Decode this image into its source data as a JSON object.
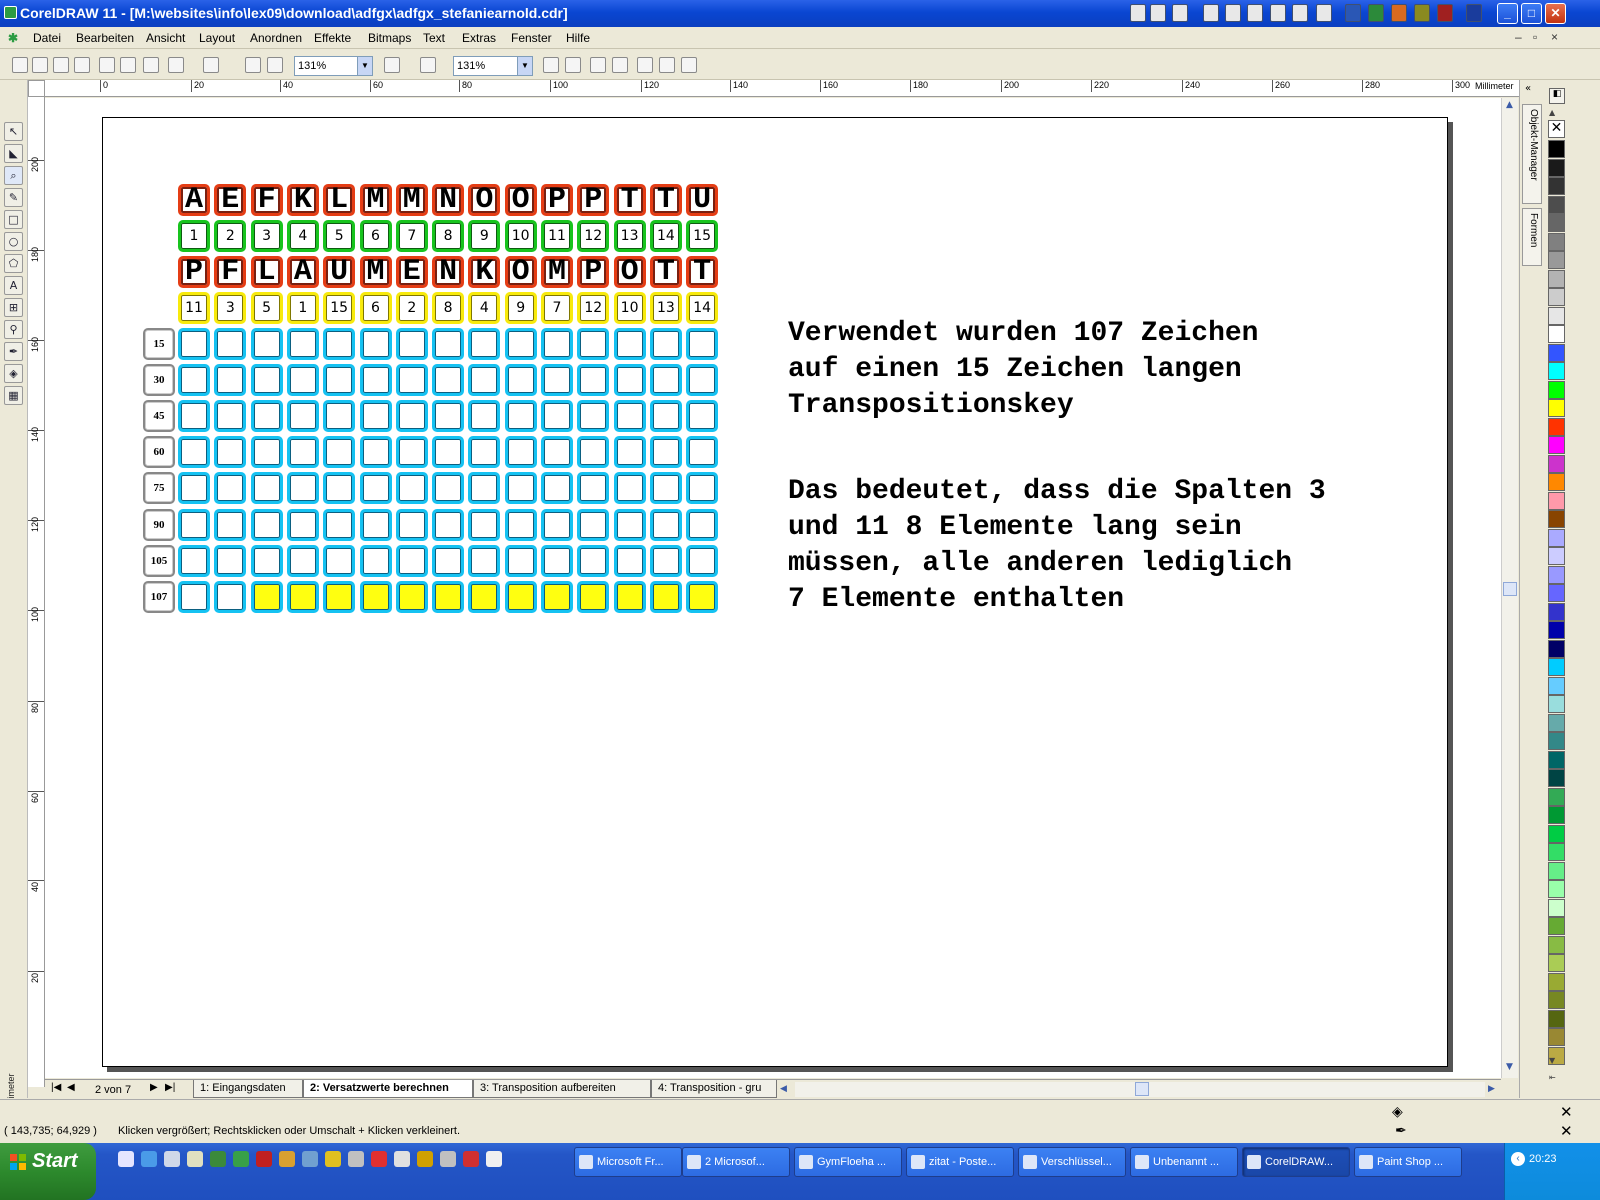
{
  "window": {
    "title": "CorelDRAW 11 - [M:\\websites\\info\\lex09\\download\\adfgx\\adfgx_stefaniearnold.cdr]"
  },
  "menu": [
    "Datei",
    "Bearbeiten",
    "Ansicht",
    "Layout",
    "Anordnen",
    "Effekte",
    "Bitmaps",
    "Text",
    "Extras",
    "Fenster",
    "Hilfe"
  ],
  "toolbar": {
    "zoom1": "131%",
    "zoom2": "131%"
  },
  "ruler": {
    "unit": "Millimeter",
    "h_ticks": [
      "0",
      "20",
      "40",
      "60",
      "80",
      "100",
      "120",
      "140",
      "160",
      "180",
      "200",
      "220",
      "240",
      "260",
      "280",
      "300"
    ],
    "v_ticks": [
      "200",
      "180",
      "160",
      "140",
      "120",
      "100",
      "80",
      "60",
      "40",
      "20"
    ],
    "v_unit": "Millimeter"
  },
  "grid": {
    "letters_row1": [
      "A",
      "E",
      "F",
      "K",
      "L",
      "M",
      "M",
      "N",
      "O",
      "O",
      "P",
      "P",
      "T",
      "T",
      "U"
    ],
    "numbers_row": [
      "1",
      "2",
      "3",
      "4",
      "5",
      "6",
      "7",
      "8",
      "9",
      "10",
      "11",
      "12",
      "13",
      "14",
      "15"
    ],
    "letters_row2": [
      "P",
      "F",
      "L",
      "A",
      "U",
      "M",
      "E",
      "N",
      "K",
      "O",
      "M",
      "P",
      "O",
      "T",
      "T"
    ],
    "key_row": [
      "11",
      "3",
      "5",
      "1",
      "15",
      "6",
      "2",
      "8",
      "4",
      "9",
      "7",
      "12",
      "10",
      "13",
      "14"
    ],
    "row_labels": [
      "15",
      "30",
      "45",
      "60",
      "75",
      "90",
      "105",
      "107"
    ],
    "filled_from_col_last_row": 3
  },
  "text": {
    "paragraph1": [
      "Verwendet wurden 107 Zeichen",
      "auf einen 15 Zeichen langen",
      "Transpositionskey"
    ],
    "paragraph2": [
      "Das bedeutet, dass die Spalten 3",
      "und 11 8 Elemente lang sein",
      "müssen, alle anderen lediglich",
      "7 Elemente enthalten"
    ]
  },
  "dockers": {
    "tab1": "Objekt-Manager",
    "tab2": "Formen"
  },
  "pages": {
    "counter": "2 von 7",
    "tabs": [
      "1: Eingangsdaten",
      "2: Versatzwerte berechnen",
      "3: Transposition aufbereiten",
      "4: Transposition - gru"
    ],
    "active": 1
  },
  "status": {
    "coords": "( 143,735; 64,929 )",
    "hint": "Klicken vergrößert; Rechtsklicken oder Umschalt + Klicken verkleinert."
  },
  "taskbar": {
    "start": "Start",
    "tasks": [
      "Microsoft Fr...",
      "2 Microsof...",
      "GymFloeha ...",
      "zitat - Poste...",
      "Verschlüssel...",
      "Unbenannt ...",
      "CorelDRAW...",
      "Paint Shop ..."
    ],
    "active_task": 6,
    "clock": "20:23"
  },
  "palette": [
    "#000000",
    "#1a1a1a",
    "#333333",
    "#4d4d4d",
    "#666666",
    "#808080",
    "#999999",
    "#b3b3b3",
    "#cccccc",
    "#e6e6e6",
    "#ffffff",
    "#3355ff",
    "#00ffff",
    "#00ff00",
    "#ffff00",
    "#ff3300",
    "#ff00ff",
    "#cc33cc",
    "#ff8800",
    "#ff99aa",
    "#884400",
    "#aaaaff",
    "#ccccff",
    "#9999ff",
    "#6666ff",
    "#3333cc",
    "#0000aa",
    "#000066",
    "#00ccff",
    "#66ccff",
    "#99dddd",
    "#66aaaa",
    "#338888",
    "#006666",
    "#004444",
    "#33aa55",
    "#009933",
    "#00cc44",
    "#33dd66",
    "#66ee88",
    "#99ffaa",
    "#ccffcc",
    "#66aa33",
    "#88bb44",
    "#aacc55",
    "#99aa33",
    "#778822",
    "#556611",
    "#998833",
    "#bbaa44"
  ]
}
